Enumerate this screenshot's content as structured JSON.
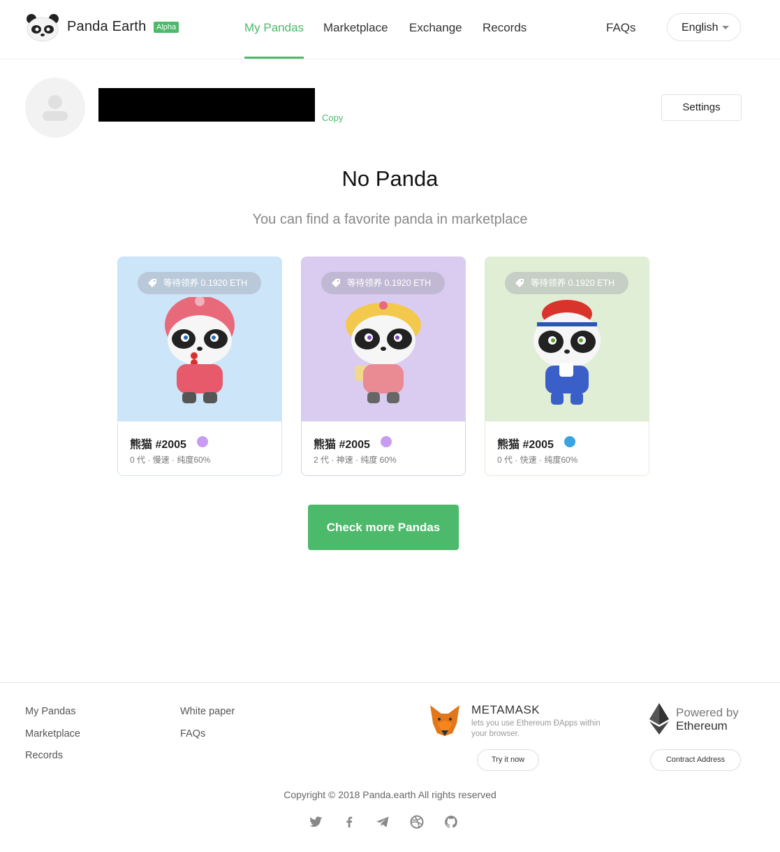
{
  "header": {
    "brand": "Panda Earth",
    "badge": "Alpha",
    "nav": [
      "My Pandas",
      "Marketplace",
      "Exchange",
      "Records",
      "FAQs"
    ],
    "language": "English",
    "accent": "#4cb96b"
  },
  "profile": {
    "copy_label": "Copy",
    "settings_label": "Settings"
  },
  "empty_state": {
    "title": "No Panda",
    "subtitle": "You can find a favorite panda in marketplace"
  },
  "cards": [
    {
      "price": "等待领养 0.1920 ETH",
      "name": "熊猫 #2005",
      "meta": "0 代 · 慢速 · 纯度60%",
      "bg": "#cde5f8",
      "gem": "#c89cf0",
      "icon": "purple-gem-icon"
    },
    {
      "price": "等待领养 0.1920 ETH",
      "name": "熊猫 #2005",
      "meta": "2 代 · 神速 · 纯度 60%",
      "bg": "#d9ccf0",
      "gem": "#c89cf0",
      "icon": "purple-gem-icon"
    },
    {
      "price": "等待领养 0.1920 ETH",
      "name": "熊猫 #2005",
      "meta": "0 代 · 快速 · 纯度60%",
      "bg": "#e1eed6",
      "gem": "#3aa3e0",
      "icon": "blue-gem-icon"
    }
  ],
  "cta_label": "Check more Pandas",
  "footer": {
    "col1": [
      "My Pandas",
      "Marketplace",
      "Records"
    ],
    "col2": [
      "White paper",
      "FAQs"
    ],
    "metamask_title": "METAMASK",
    "metamask_desc": "lets you use Ethereum ĐApps within your browser.",
    "try_label": "Try it now",
    "powered_1": "Powered by",
    "powered_2": "Ethereum",
    "contract_label": "Contract Address",
    "copyright": "Copyright © 2018 Panda.earth All rights reserved",
    "social": [
      "twitter-icon",
      "facebook-icon",
      "telegram-icon",
      "dribbble-icon",
      "github-icon"
    ]
  }
}
